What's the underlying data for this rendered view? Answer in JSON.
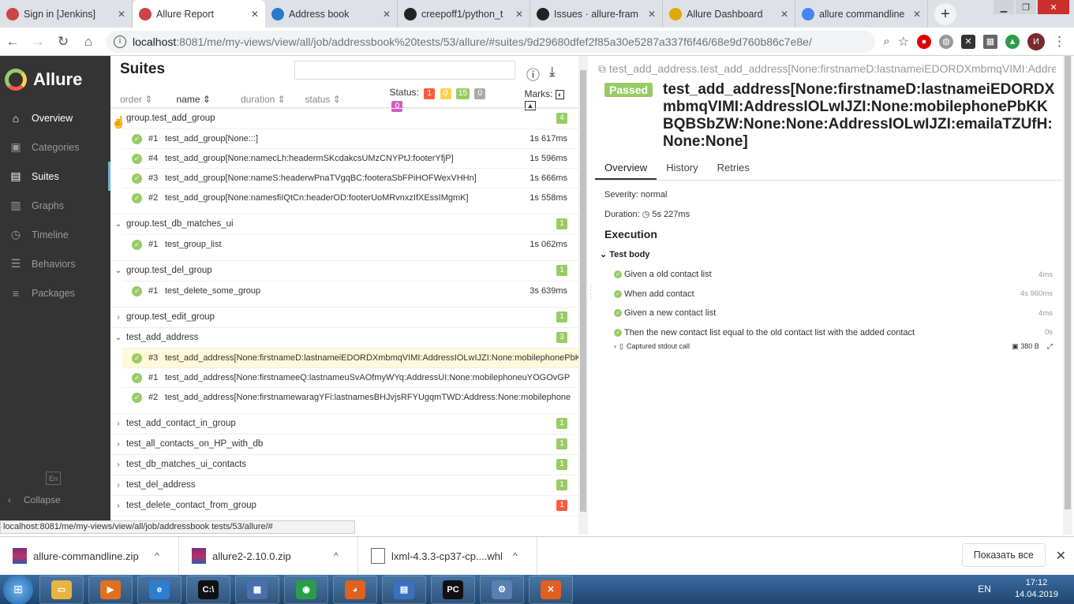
{
  "browser": {
    "tabs": [
      {
        "title": "Sign in [Jenkins]",
        "icon": "jenkins-icon",
        "color": "#c44"
      },
      {
        "title": "Allure Report",
        "icon": "jenkins-icon",
        "color": "#c44",
        "active": true
      },
      {
        "title": "Address book",
        "icon": "vscode-icon",
        "color": "#2a7acc"
      },
      {
        "title": "creepoff1/python_t",
        "icon": "github-icon",
        "color": "#222"
      },
      {
        "title": "Issues · allure-fram",
        "icon": "github-icon",
        "color": "#222"
      },
      {
        "title": "Allure Dashboard",
        "icon": "allure-icon",
        "color": "#e0a800"
      },
      {
        "title": "allure commandline",
        "icon": "google-icon",
        "color": "#4285f4"
      }
    ],
    "new_tab": "+",
    "url_host": "localhost",
    "url_rest": ":8081/me/my-views/view/all/job/addressbook%20tests/53/allure/#suites/9d29680dfef2f85a30e5287a337f6f46/68e9d760b86c7e8e/",
    "status_url": "localhost:8081/me/my-views/view/all/job/addressbook tests/53/allure/#",
    "profile_initial": "И"
  },
  "sidebar": {
    "brand": "Allure",
    "items": [
      {
        "label": "Overview",
        "icon": "home-icon",
        "glyph": "⌂"
      },
      {
        "label": "Categories",
        "icon": "briefcase-icon",
        "glyph": "▣"
      },
      {
        "label": "Suites",
        "icon": "suitcase-icon",
        "glyph": "▤"
      },
      {
        "label": "Graphs",
        "icon": "bar-chart-icon",
        "glyph": "▥"
      },
      {
        "label": "Timeline",
        "icon": "clock-icon",
        "glyph": "◷"
      },
      {
        "label": "Behaviors",
        "icon": "list-icon",
        "glyph": "☰"
      },
      {
        "label": "Packages",
        "icon": "menu-icon",
        "glyph": "≡"
      }
    ],
    "lang": "En",
    "collapse": "Collapse"
  },
  "suites": {
    "title": "Suites",
    "sort": {
      "order": "order",
      "name": "name",
      "duration": "duration",
      "status": "status"
    },
    "status_label": "Status:",
    "status_counts": {
      "failed": "1",
      "broken": "0",
      "passed": "15",
      "skipped": "0",
      "unknown": "0"
    },
    "marks_label": "Marks:",
    "groups": [
      {
        "name": "group.test_add_group",
        "count": "4",
        "status": "passed",
        "open": true,
        "items": [
          {
            "num": "#1",
            "name": "test_add_group[None:::]",
            "dur": "1s 617ms"
          },
          {
            "num": "#4",
            "name": "test_add_group[None:namecLh:headermSKcdakcsUMzCNYPtJ:footerYfjP]",
            "dur": "1s 596ms"
          },
          {
            "num": "#3",
            "name": "test_add_group[None:nameS:headerwPnaTVgqBC:footeraSbFPiHOFWexVHHn]",
            "dur": "1s 666ms"
          },
          {
            "num": "#2",
            "name": "test_add_group[None:namesfiIQtCn:headerOD:footerUoMRvnxzIfXEssIMgmK]",
            "dur": "1s 558ms"
          }
        ]
      },
      {
        "name": "group.test_db_matches_ui",
        "count": "1",
        "status": "passed",
        "open": true,
        "items": [
          {
            "num": "#1",
            "name": "test_group_list",
            "dur": "1s 062ms"
          }
        ]
      },
      {
        "name": "group.test_del_group",
        "count": "1",
        "status": "passed",
        "open": true,
        "items": [
          {
            "num": "#1",
            "name": "test_delete_some_group",
            "dur": "3s 639ms"
          }
        ]
      },
      {
        "name": "group.test_edit_group",
        "count": "1",
        "status": "passed",
        "open": false,
        "items": []
      },
      {
        "name": "test_add_address",
        "count": "3",
        "status": "passed",
        "open": true,
        "items": [
          {
            "num": "#3",
            "name": "test_add_address[None:firstnameD:lastnameiEDORDXmbmqVIMI:AddressIOLwIJZI:None:mobilephonePbKKBQBSbZW:None:None:AddressIOLwIJZI:emailaTZUfH:None:None]",
            "dur": "",
            "selected": true
          },
          {
            "num": "#1",
            "name": "test_add_address[None:firstnameeQ:lastnameuSvAOfmyWYq:AddressUI:None:mobilephoneuYOGOvGP",
            "dur": ""
          },
          {
            "num": "#2",
            "name": "test_add_address[None:firstnamewaragYFi:lastnamesBHJvjsRFYUgqmTWD:Address:None:mobilephone",
            "dur": ""
          }
        ]
      },
      {
        "name": "test_add_contact_in_group",
        "count": "1",
        "status": "passed",
        "open": false,
        "items": []
      },
      {
        "name": "test_all_contacts_on_HP_with_db",
        "count": "1",
        "status": "passed",
        "open": false,
        "items": []
      },
      {
        "name": "test_db_matches_ui_contacts",
        "count": "1",
        "status": "passed",
        "open": false,
        "items": []
      },
      {
        "name": "test_del_address",
        "count": "1",
        "status": "passed",
        "open": false,
        "items": []
      },
      {
        "name": "test_delete_contact_from_group",
        "count": "1",
        "status": "failed",
        "open": false,
        "items": []
      },
      {
        "name": "",
        "count": "1",
        "status": "passed",
        "open": false,
        "items": []
      }
    ]
  },
  "detail": {
    "crumb": "test_add_address.test_add_address[None:firstnameD:lastnameiEDORDXmbmqVIMI:AddressIOLwIJZI:None:mobilephonePbKKBQBSbZW:None:None:AddressIOLwIJZI:emailaTZUfH:None:None]",
    "status": "Passed",
    "title": "test_add_address[None:firstnameD:lastnameiEDORDXmbmqVIMI:AddressIOLwIJZI:None:mobilephonePbKKBQBSbZW:None:None:AddressIOLwIJZI:emailaTZUfH:None:None]",
    "tabs": [
      "Overview",
      "History",
      "Retries"
    ],
    "severity": "Severity: normal",
    "duration_label": "Duration:",
    "duration": "5s 227ms",
    "execution": "Execution",
    "test_body": "Test body",
    "steps": [
      {
        "name": "Given a old contact list",
        "dur": "4ms"
      },
      {
        "name": "When add contact",
        "dur": "4s 960ms"
      },
      {
        "name": "Given a new contact list",
        "dur": "4ms"
      },
      {
        "name": "Then the new contact list equal to the old contact list with the added contact",
        "dur": "0s"
      }
    ],
    "attachment": {
      "name": "Captured stdout call",
      "size": "380 B"
    }
  },
  "downloads": {
    "items": [
      {
        "name": "allure-commandline.zip",
        "icon": "winrar-icon"
      },
      {
        "name": "allure2-2.10.0.zip",
        "icon": "winrar-icon"
      },
      {
        "name": "lxml-4.3.3-cp37-cp....whl",
        "icon": "file-icon"
      }
    ],
    "show_all": "Показать все"
  },
  "taskbar": {
    "apps": [
      {
        "icon": "explorer-icon",
        "label": "▭",
        "color": "#e8b440"
      },
      {
        "icon": "media-player-icon",
        "label": "▶",
        "color": "#e07020"
      },
      {
        "icon": "ie-icon",
        "label": "e",
        "color": "#2a80d0"
      },
      {
        "icon": "cmd-icon",
        "label": "C:\\",
        "color": "#111"
      },
      {
        "icon": "network-icon",
        "label": "▦",
        "color": "#4a6fb0"
      },
      {
        "icon": "chrome-icon",
        "label": "◉",
        "color": "#2a9d4a"
      },
      {
        "icon": "firefox-icon",
        "label": "◕",
        "color": "#e06020"
      },
      {
        "icon": "remote-desktop-icon",
        "label": "▤",
        "color": "#3a70c0"
      },
      {
        "icon": "pycharm-icon",
        "label": "PC",
        "color": "#111"
      },
      {
        "icon": "settings-icon",
        "label": "⚙",
        "color": "#5a7fb0"
      },
      {
        "icon": "xampp-icon",
        "label": "✕",
        "color": "#e06020"
      }
    ],
    "lang": "EN",
    "time": "17:12",
    "date": "14.04.2019"
  }
}
